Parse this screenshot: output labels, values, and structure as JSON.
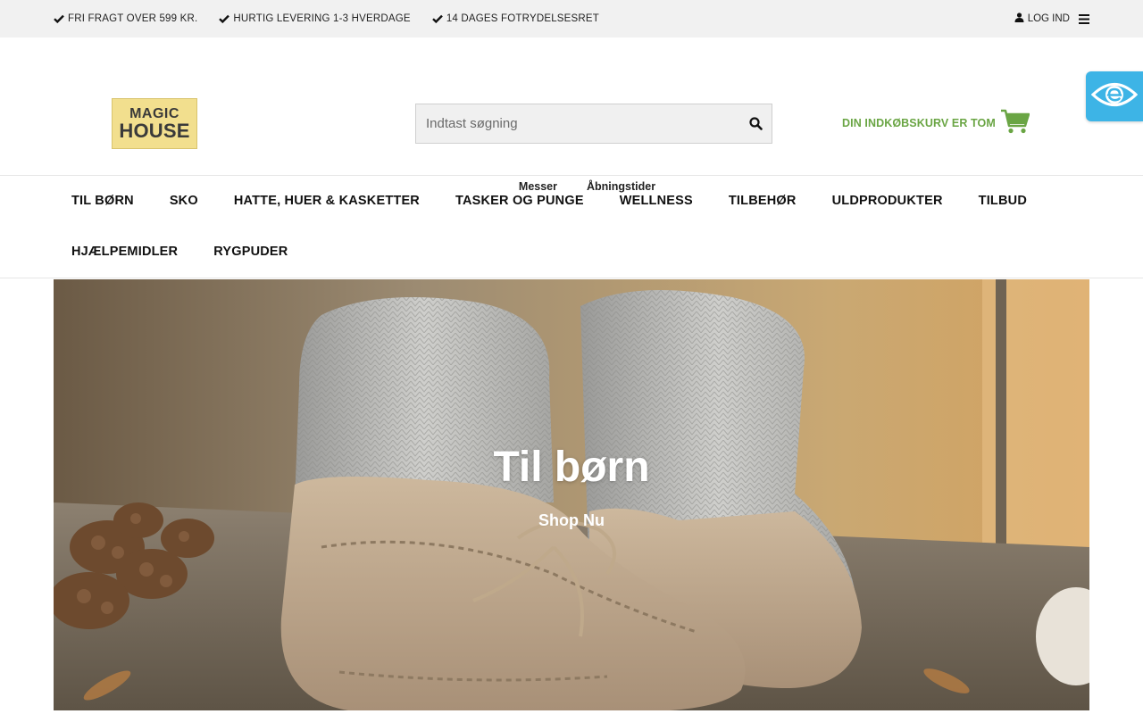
{
  "topbar": {
    "usps": [
      {
        "icon": "check-icon",
        "text": "FRI FRAGT OVER 599 KR."
      },
      {
        "icon": "check-icon",
        "text": "HURTIG LEVERING 1-3 HVERDAGE"
      },
      {
        "icon": "check-icon",
        "text": "14 DAGES FOTRYDELSESRET"
      }
    ],
    "login_label": "LOG IND",
    "login_icon": "user-icon",
    "menu_icon": "hamburger-menu-icon"
  },
  "header": {
    "logo": {
      "line1": "MAGIC",
      "line2": "HOUSE"
    },
    "search": {
      "placeholder": "Indtast søgning",
      "value": "",
      "icon": "search-icon"
    },
    "cart": {
      "label": "DIN INDKØBSKURV ER TOM",
      "icon": "shopping-cart-icon"
    },
    "sublinks": [
      "Messer",
      "Åbningstider"
    ]
  },
  "accessibility_widget": {
    "icon": "eye-icon"
  },
  "nav": {
    "row1": [
      "TIL BØRN",
      "SKO",
      "HATTE, HUER & KASKETTER",
      "TASKER OG PUNGE",
      "WELLNESS",
      "TILBEHØR",
      "ULDPRODUKTER",
      "TILBUD"
    ],
    "row2": [
      "HJÆLPEMIDLER",
      "RYGPUDER"
    ]
  },
  "hero": {
    "title": "Til børn",
    "cta": "Shop Nu"
  },
  "colors": {
    "accent_green": "#6aa544",
    "topbar_bg": "#f1f1f1",
    "widget_blue": "#3db4e6",
    "logo_yellow": "#f2df8e"
  }
}
